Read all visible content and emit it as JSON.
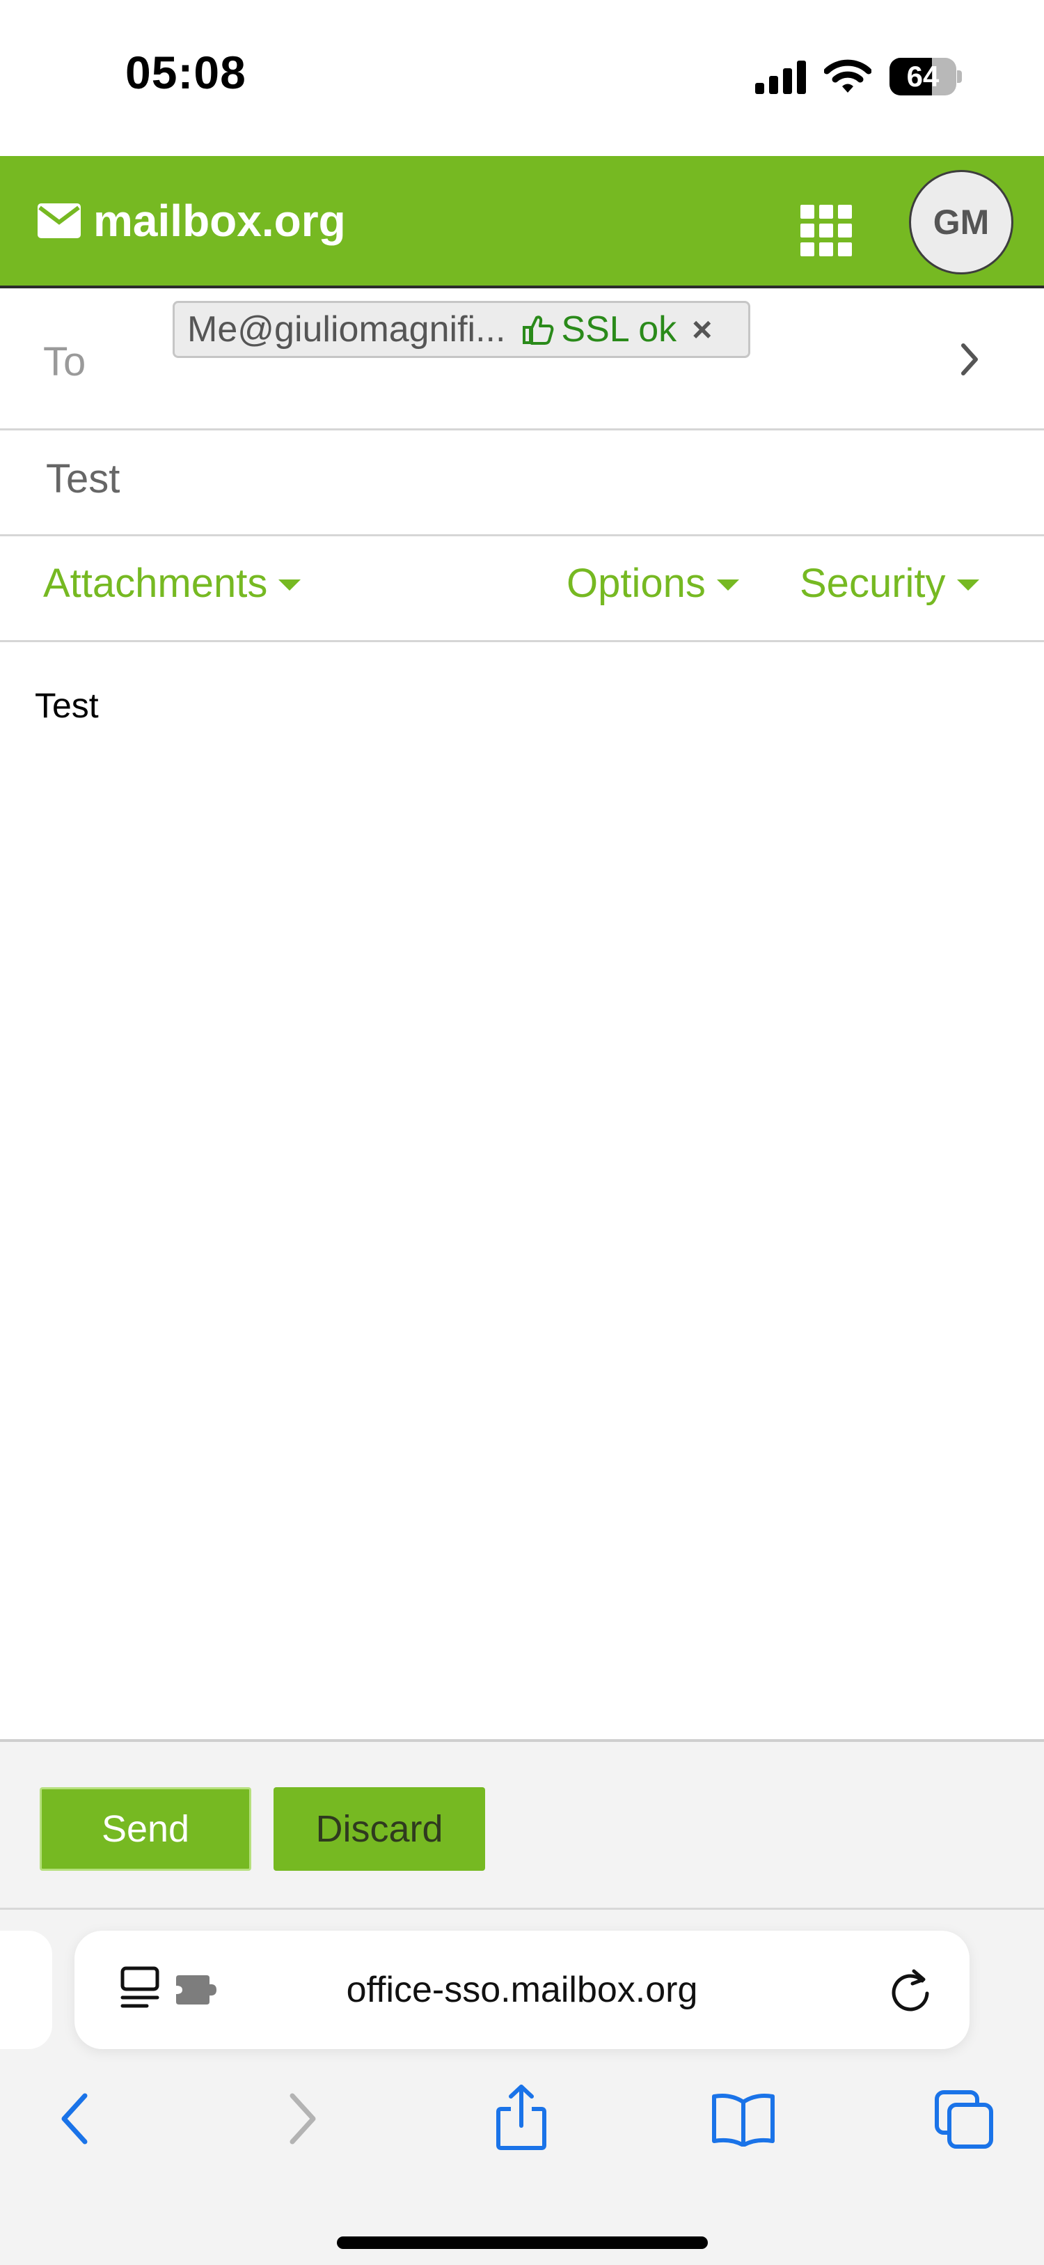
{
  "status_bar": {
    "time": "05:08",
    "battery_percent": "64",
    "battery_level": 0.64,
    "icons": [
      "cellular-signal-icon",
      "wifi-icon",
      "battery-icon"
    ]
  },
  "header": {
    "brand": "mailbox.org",
    "logo_icon": "envelope-icon",
    "apps_icon": "app-grid-icon",
    "avatar_initials": "GM",
    "color": "#76b922"
  },
  "compose": {
    "to_label": "To",
    "recipient": {
      "address": "Me@giuliomagnifi...",
      "ssl_status": "SSL ok",
      "ssl_icon": "thumbs-up-icon",
      "remove_icon": "close-icon"
    },
    "expand_icon": "chevron-right-icon",
    "subject": "Test",
    "menus": {
      "attachments": "Attachments",
      "options": "Options",
      "security": "Security"
    },
    "body": "Test"
  },
  "actions": {
    "send_label": "Send",
    "discard_label": "Discard"
  },
  "browser": {
    "url": "office-sso.mailbox.org",
    "toolbar_icons": [
      "back-icon",
      "forward-icon",
      "share-icon",
      "bookmarks-icon",
      "tabs-icon"
    ]
  }
}
